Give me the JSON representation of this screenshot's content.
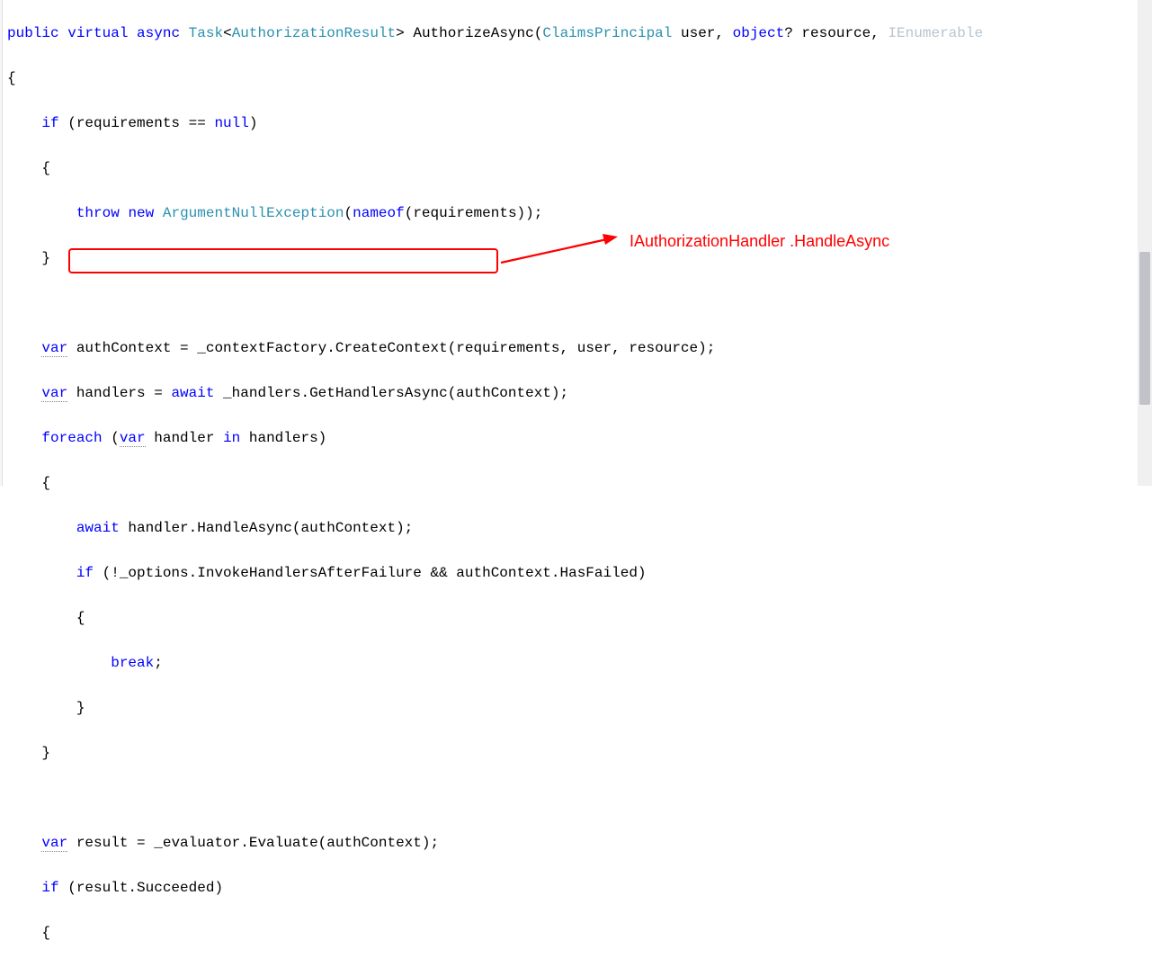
{
  "annotation": {
    "label": "IAuthorizationHandler .HandleAsync",
    "color": "#ff0000"
  },
  "code": {
    "l1": {
      "public": "public",
      "virtual": "virtual",
      "async": "async",
      "task": "Task",
      "lt": "<",
      "authresult": "AuthorizationResult",
      "gt": ">",
      "method": " AuthorizeAsync(",
      "claims": "ClaimsPrincipal",
      "user": " user, ",
      "object": "object",
      "q": "?",
      "resource": " resource, ",
      "ienum": "IEnumerable"
    },
    "l2": {
      "brace": "{"
    },
    "l3": {
      "if": "if",
      "cond": " (requirements == ",
      "null": "null",
      "close": ")"
    },
    "l4": {
      "brace": "    {"
    },
    "l5": {
      "throw": "throw",
      "sp": " ",
      "new": "new",
      "sp2": " ",
      "argex": "ArgumentNullException",
      "open": "(",
      "nameof": "nameof",
      "args": "(requirements));"
    },
    "l6": {
      "brace": "    }"
    },
    "l7": {
      "blank": ""
    },
    "l8": {
      "var": "var",
      "rest": " authContext = _contextFactory.CreateContext(requirements, user, resource);"
    },
    "l9": {
      "var": "var",
      "mid": " handlers = ",
      "await": "await",
      "rest": " _handlers.GetHandlersAsync(authContext);"
    },
    "l10": {
      "foreach": "foreach",
      "open": " (",
      "var": "var",
      "rest": " handler ",
      "in": "in",
      "rest2": " handlers)"
    },
    "l11": {
      "brace": "    {"
    },
    "l12": {
      "await": "await",
      "rest": " handler.HandleAsync(authContext);"
    },
    "l13": {
      "if": "if",
      "rest": " (!_options.InvokeHandlersAfterFailure && authContext.HasFailed)"
    },
    "l14": {
      "brace": "        {"
    },
    "l15": {
      "break": "break",
      "semi": ";"
    },
    "l16": {
      "brace": "        }"
    },
    "l17": {
      "brace": "    }"
    },
    "l18": {
      "blank": ""
    },
    "l19": {
      "var": "var",
      "rest": " result = _evaluator.Evaluate(authContext);"
    },
    "l20": {
      "if": "if",
      "rest": " (result.Succeeded)"
    },
    "l21": {
      "brace": "    {"
    }
  }
}
